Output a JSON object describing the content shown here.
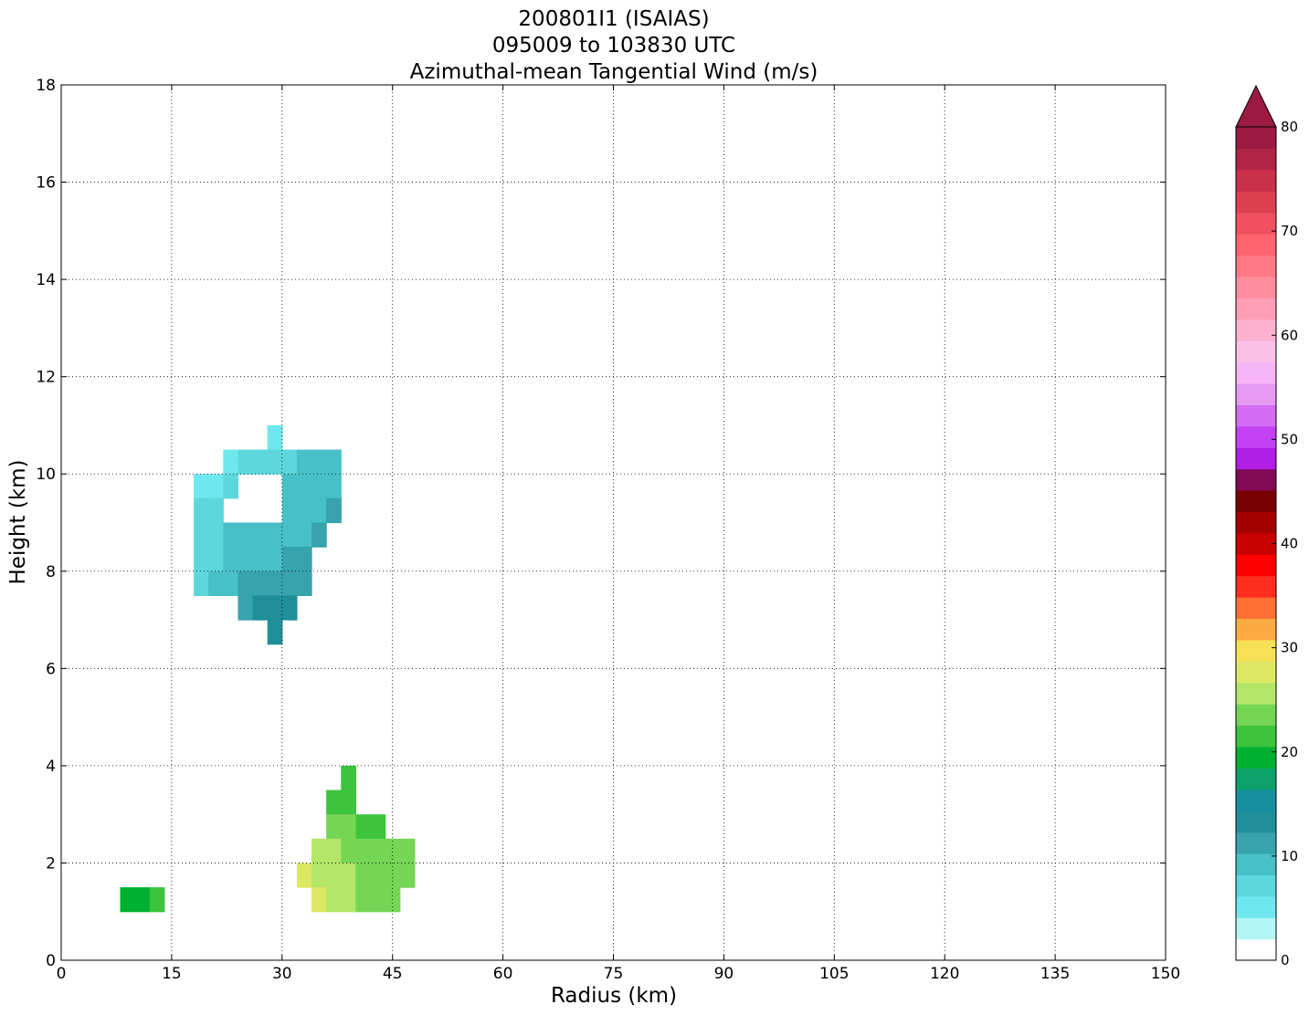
{
  "chart_data": {
    "type": "heatmap",
    "title": [
      "200801I1 (ISAIAS)",
      "095009 to 103830 UTC",
      "Azimuthal-mean Tangential Wind (m/s)"
    ],
    "xlabel": "Radius (km)",
    "ylabel": "Height (km)",
    "xlim": [
      0,
      150
    ],
    "ylim": [
      0,
      18
    ],
    "xticks": [
      0,
      15,
      30,
      45,
      60,
      75,
      90,
      105,
      120,
      135,
      150
    ],
    "yticks": [
      0,
      2,
      4,
      6,
      8,
      10,
      12,
      14,
      16,
      18
    ],
    "grid": true,
    "colorbar": {
      "min": 0,
      "max": 80,
      "step": 2,
      "extend": "max",
      "ticks": [
        0,
        10,
        20,
        30,
        40,
        50,
        60,
        70,
        80
      ],
      "colors": [
        "#ffffff",
        "#b3f5f5",
        "#6ee8ee",
        "#5cd8dc",
        "#48c0c8",
        "#36a3ad",
        "#1f8f9a",
        "#168e9e",
        "#0ca06a",
        "#00b030",
        "#3cc43c",
        "#74d654",
        "#b4e668",
        "#dce864",
        "#f7e055",
        "#fbab42",
        "#fe7133",
        "#fe2e1e",
        "#ff0000",
        "#c80000",
        "#a30000",
        "#780000",
        "#820a55",
        "#b01ee6",
        "#c241f4",
        "#d46cf4",
        "#e79af4",
        "#f5b4f5",
        "#fcc0e8",
        "#fdb2cf",
        "#fe9eb6",
        "#ff8d9e",
        "#ff7a86",
        "#ff6470",
        "#f05060",
        "#dc4050",
        "#c8304a",
        "#b02445",
        "#9c1a42"
      ]
    },
    "series": [
      {
        "values": [
          [
            18,
            10,
            20,
            9.5,
            2
          ],
          [
            18,
            9.5,
            20,
            9,
            3
          ],
          [
            20,
            10,
            22,
            9.5,
            2
          ],
          [
            20,
            9.5,
            22,
            9,
            3
          ],
          [
            22,
            10.5,
            24,
            10,
            2
          ],
          [
            22,
            10,
            24,
            9.5,
            3
          ],
          [
            24,
            10.5,
            26,
            10,
            3
          ],
          [
            26,
            10.5,
            28,
            10,
            3
          ],
          [
            28,
            11,
            30,
            10.5,
            2
          ],
          [
            28,
            10.5,
            30,
            10,
            3
          ],
          [
            30,
            10.5,
            32,
            10,
            3
          ],
          [
            32,
            10.5,
            34,
            10,
            4
          ],
          [
            34,
            10.5,
            36,
            10,
            4
          ],
          [
            36,
            10.5,
            38,
            10,
            4
          ],
          [
            18,
            9,
            20,
            8.5,
            3
          ],
          [
            20,
            9,
            22,
            8.5,
            3
          ],
          [
            22,
            9,
            24,
            8.5,
            4
          ],
          [
            24,
            9,
            26,
            8.5,
            4
          ],
          [
            26,
            9,
            28,
            8.5,
            4
          ],
          [
            28,
            9,
            30,
            8.5,
            4
          ],
          [
            30,
            10,
            32,
            9.5,
            4
          ],
          [
            32,
            10,
            34,
            9.5,
            4
          ],
          [
            34,
            10,
            36,
            9.5,
            4
          ],
          [
            36,
            10,
            38,
            9.5,
            4
          ],
          [
            30,
            9.5,
            32,
            9,
            4
          ],
          [
            32,
            9.5,
            34,
            9,
            4
          ],
          [
            34,
            9.5,
            36,
            9,
            4
          ],
          [
            36,
            9.5,
            38,
            9,
            5
          ],
          [
            18,
            8.5,
            20,
            8,
            3
          ],
          [
            20,
            8.5,
            22,
            8,
            3
          ],
          [
            22,
            8.5,
            24,
            8,
            4
          ],
          [
            24,
            8.5,
            26,
            8,
            4
          ],
          [
            26,
            8.5,
            28,
            8,
            4
          ],
          [
            28,
            8.5,
            30,
            8,
            4
          ],
          [
            30,
            9,
            32,
            8.5,
            4
          ],
          [
            32,
            9,
            34,
            8.5,
            4
          ],
          [
            34,
            9,
            36,
            8.5,
            5
          ],
          [
            30,
            8.5,
            32,
            8,
            5
          ],
          [
            32,
            8.5,
            34,
            8,
            5
          ],
          [
            18,
            8,
            20,
            7.5,
            3
          ],
          [
            20,
            8,
            22,
            7.5,
            4
          ],
          [
            22,
            8,
            24,
            7.5,
            4
          ],
          [
            24,
            8,
            26,
            7.5,
            5
          ],
          [
            26,
            8,
            28,
            7.5,
            5
          ],
          [
            28,
            8,
            30,
            7.5,
            5
          ],
          [
            30,
            8,
            32,
            7.5,
            5
          ],
          [
            32,
            8,
            34,
            7.5,
            5
          ],
          [
            24,
            7.5,
            26,
            7,
            5
          ],
          [
            26,
            7.5,
            28,
            7,
            6
          ],
          [
            28,
            7.5,
            30,
            7,
            6
          ],
          [
            30,
            7.5,
            32,
            7,
            6
          ],
          [
            28,
            7,
            30,
            6.5,
            6
          ],
          [
            38,
            4,
            40,
            3.5,
            10
          ],
          [
            36,
            3.5,
            38,
            3,
            10
          ],
          [
            38,
            3.5,
            40,
            3,
            10
          ],
          [
            36,
            3,
            38,
            2.5,
            11
          ],
          [
            38,
            3,
            40,
            2.5,
            11
          ],
          [
            40,
            3,
            42,
            2.5,
            10
          ],
          [
            42,
            3,
            44,
            2.5,
            10
          ],
          [
            34,
            2.5,
            36,
            2,
            12
          ],
          [
            36,
            2.5,
            38,
            2,
            12
          ],
          [
            38,
            2.5,
            40,
            2,
            11
          ],
          [
            40,
            2.5,
            42,
            2,
            11
          ],
          [
            42,
            2.5,
            44,
            2,
            11
          ],
          [
            44,
            2.5,
            46,
            2,
            11
          ],
          [
            46,
            2.5,
            48,
            2,
            11
          ],
          [
            32,
            2,
            34,
            1.5,
            13
          ],
          [
            34,
            2,
            36,
            1.5,
            12
          ],
          [
            36,
            2,
            38,
            1.5,
            12
          ],
          [
            38,
            2,
            40,
            1.5,
            12
          ],
          [
            40,
            2,
            42,
            1.5,
            11
          ],
          [
            42,
            2,
            44,
            1.5,
            11
          ],
          [
            44,
            2,
            46,
            1.5,
            11
          ],
          [
            46,
            2,
            48,
            1.5,
            11
          ],
          [
            34,
            1.5,
            36,
            1,
            13
          ],
          [
            36,
            1.5,
            38,
            1,
            12
          ],
          [
            38,
            1.5,
            40,
            1,
            12
          ],
          [
            40,
            1.5,
            42,
            1,
            11
          ],
          [
            42,
            1.5,
            44,
            1,
            11
          ],
          [
            44,
            1.5,
            46,
            1,
            11
          ],
          [
            8,
            1.5,
            10,
            1,
            9
          ],
          [
            10,
            1.5,
            12,
            1,
            9
          ],
          [
            12,
            1.5,
            14,
            1,
            10
          ]
        ]
      }
    ]
  }
}
